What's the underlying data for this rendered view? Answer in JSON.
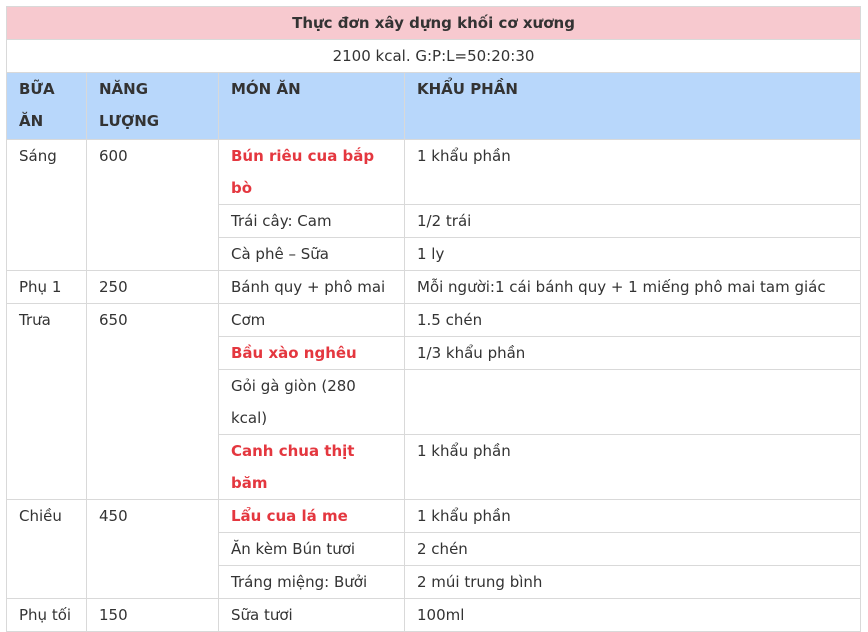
{
  "table": {
    "title": "Thực đơn xây dựng khối cơ xương",
    "subtitle": "2100 kcal. G:P:L=50:20:30",
    "headers": [
      "BỮA ĂN",
      "NĂNG LƯỢNG",
      "MÓN ĂN",
      "KHẨU PHẦN"
    ],
    "highlight_color": "#e4373f",
    "title_bg": "#f7c9cf",
    "header_bg": "#b8d7fb",
    "meals": [
      {
        "meal": "Sáng",
        "energy": "600",
        "items": [
          {
            "dish": "Bún riêu cua bắp bò",
            "portion": "1 khẩu phần",
            "highlight": true
          },
          {
            "dish": "Trái cây: Cam",
            "portion": "1/2 trái",
            "highlight": false
          },
          {
            "dish": "Cà phê – Sữa",
            "portion": "1 ly",
            "highlight": false
          }
        ]
      },
      {
        "meal": "Phụ 1",
        "energy": "250",
        "items": [
          {
            "dish": "Bánh quy + phô mai",
            "portion": "Mỗi người:1 cái bánh quy + 1 miếng phô mai tam giác",
            "highlight": false
          }
        ]
      },
      {
        "meal": "Trưa",
        "energy": "650",
        "items": [
          {
            "dish": "Cơm",
            "portion": "1.5 chén",
            "highlight": false
          },
          {
            "dish": "Bầu xào nghêu",
            "portion": "1/3 khẩu phần",
            "highlight": true
          },
          {
            "dish": "Gỏi gà giòn (280 kcal)",
            "portion": "",
            "highlight": false
          },
          {
            "dish": "Canh chua thịt băm",
            "portion": "1 khẩu phần",
            "highlight": true
          }
        ]
      },
      {
        "meal": "Chiều",
        "energy": "450",
        "items": [
          {
            "dish": "Lẩu cua lá me",
            "portion": "1 khẩu phần",
            "highlight": true
          },
          {
            "dish": "Ăn kèm Bún tươi",
            "portion": "2 chén",
            "highlight": false
          },
          {
            "dish": "Tráng miệng: Bưởi",
            "portion": "2 múi trung bình",
            "highlight": false
          }
        ]
      },
      {
        "meal": "Phụ tối",
        "energy": "150",
        "items": [
          {
            "dish": "Sữa tươi",
            "portion": "100ml",
            "highlight": false
          }
        ]
      }
    ]
  }
}
